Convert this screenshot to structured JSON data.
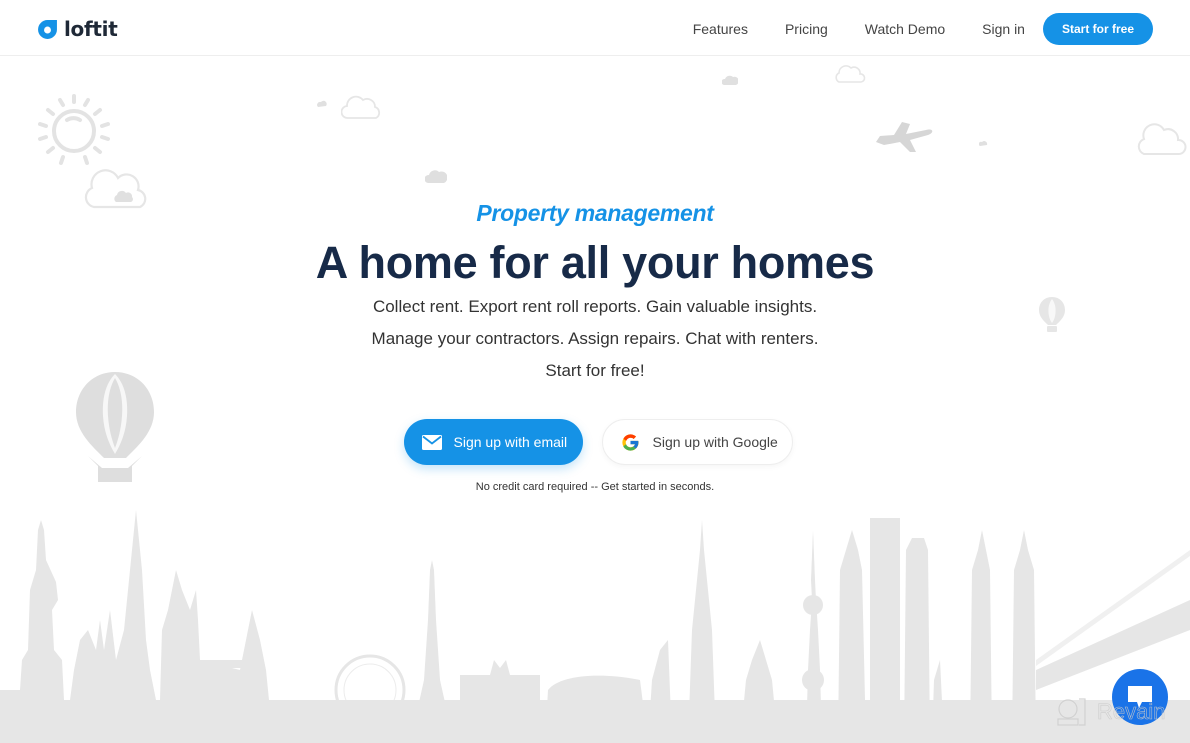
{
  "brand": {
    "name": "loftit",
    "accent": "#1592e6",
    "dark": "#172a48"
  },
  "nav": {
    "links": [
      "Features",
      "Pricing",
      "Watch Demo",
      "Sign in"
    ],
    "cta": "Start for free"
  },
  "hero": {
    "eyebrow": "Property management",
    "headline": "A home for all your homes",
    "lines": [
      "Collect rent. Export rent roll reports. Gain valuable insights.",
      "Manage your contractors. Assign repairs. Chat with renters.",
      "Start for free!"
    ]
  },
  "signup": {
    "email_label": "Sign up with email",
    "email_icon": "envelope-icon",
    "google_label": "Sign up with Google",
    "google_icon": "google-g-icon",
    "note": "No credit card required -- Get started in seconds."
  },
  "chat": {
    "icon": "chat-bubble-icon"
  },
  "watermark": {
    "text": "Revain"
  }
}
